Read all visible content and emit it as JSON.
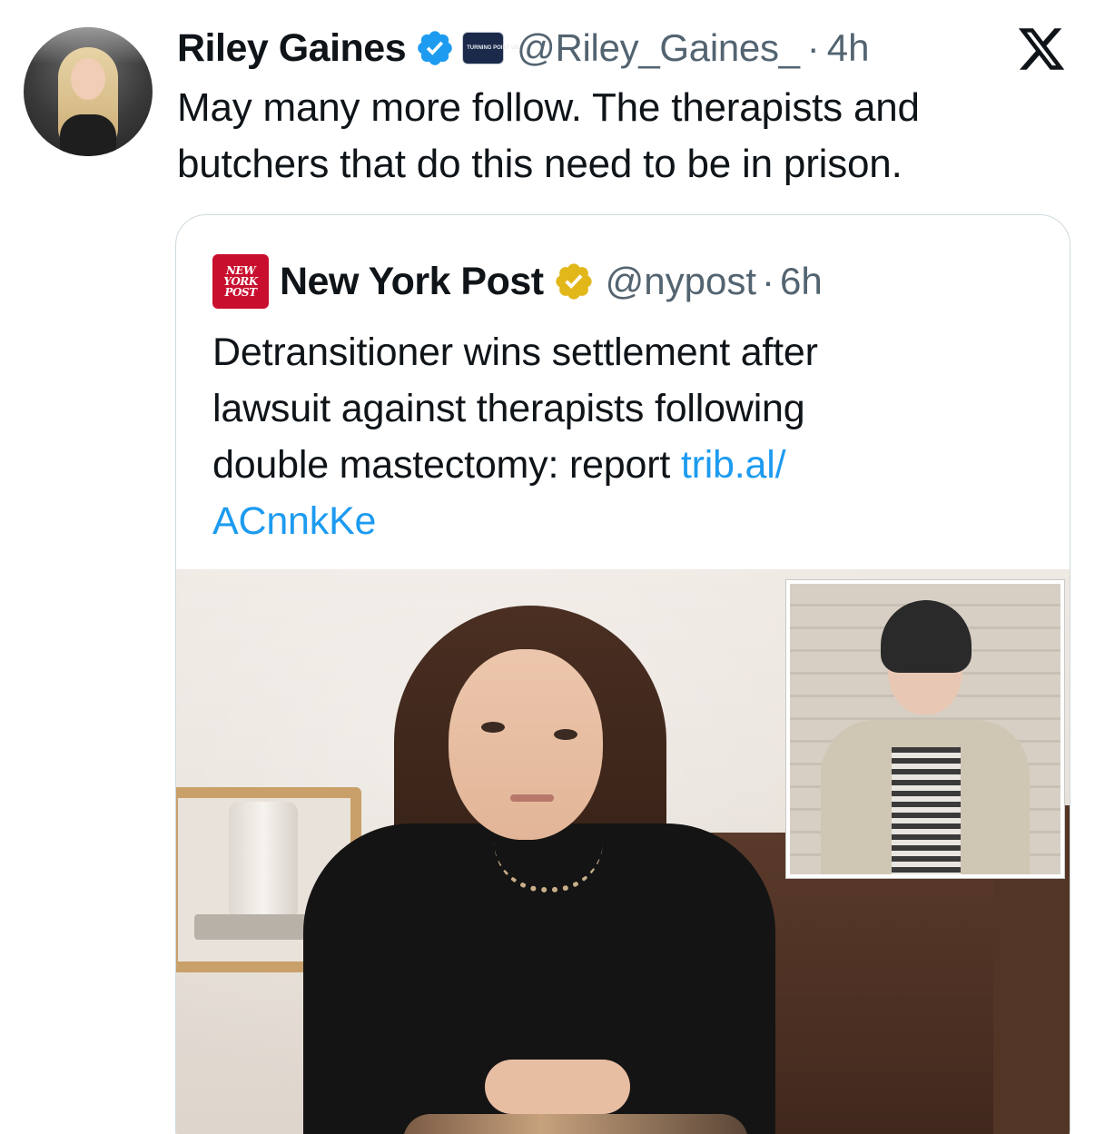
{
  "tweet": {
    "author_name": "Riley Gaines",
    "author_handle": "@Riley_Gaines_",
    "separator": "·",
    "time": "4h",
    "affiliation_badge_text": "TURNING POINT USA",
    "text_lines": [
      "May many more follow. The therapists and",
      "butchers that do this need to be in prison."
    ]
  },
  "platform_logo": "X",
  "quoted": {
    "author_name": "New York Post",
    "logo_lines": [
      "NEW",
      "YORK",
      "POST"
    ],
    "author_handle": "@nypost",
    "separator": "·",
    "time": "6h",
    "text_lines": [
      "Detransitioner wins settlement after",
      "lawsuit against therapists following"
    ],
    "text_line3_prefix": "double mastectomy: report ",
    "link_part1": "trib.al/",
    "link_part2": "ACnnkKe"
  },
  "icons": {
    "verified": "verified-badge-icon",
    "gold_verified": "gold-verified-badge-icon",
    "x_logo": "x-logo-icon"
  },
  "colors": {
    "text": "#0f1419",
    "secondary": "#536471",
    "link": "#1d9bf0",
    "verified_blue": "#1d9bf0",
    "gold": "#e2b719",
    "nypost_red": "#c8102e",
    "border": "#cfd9de"
  }
}
